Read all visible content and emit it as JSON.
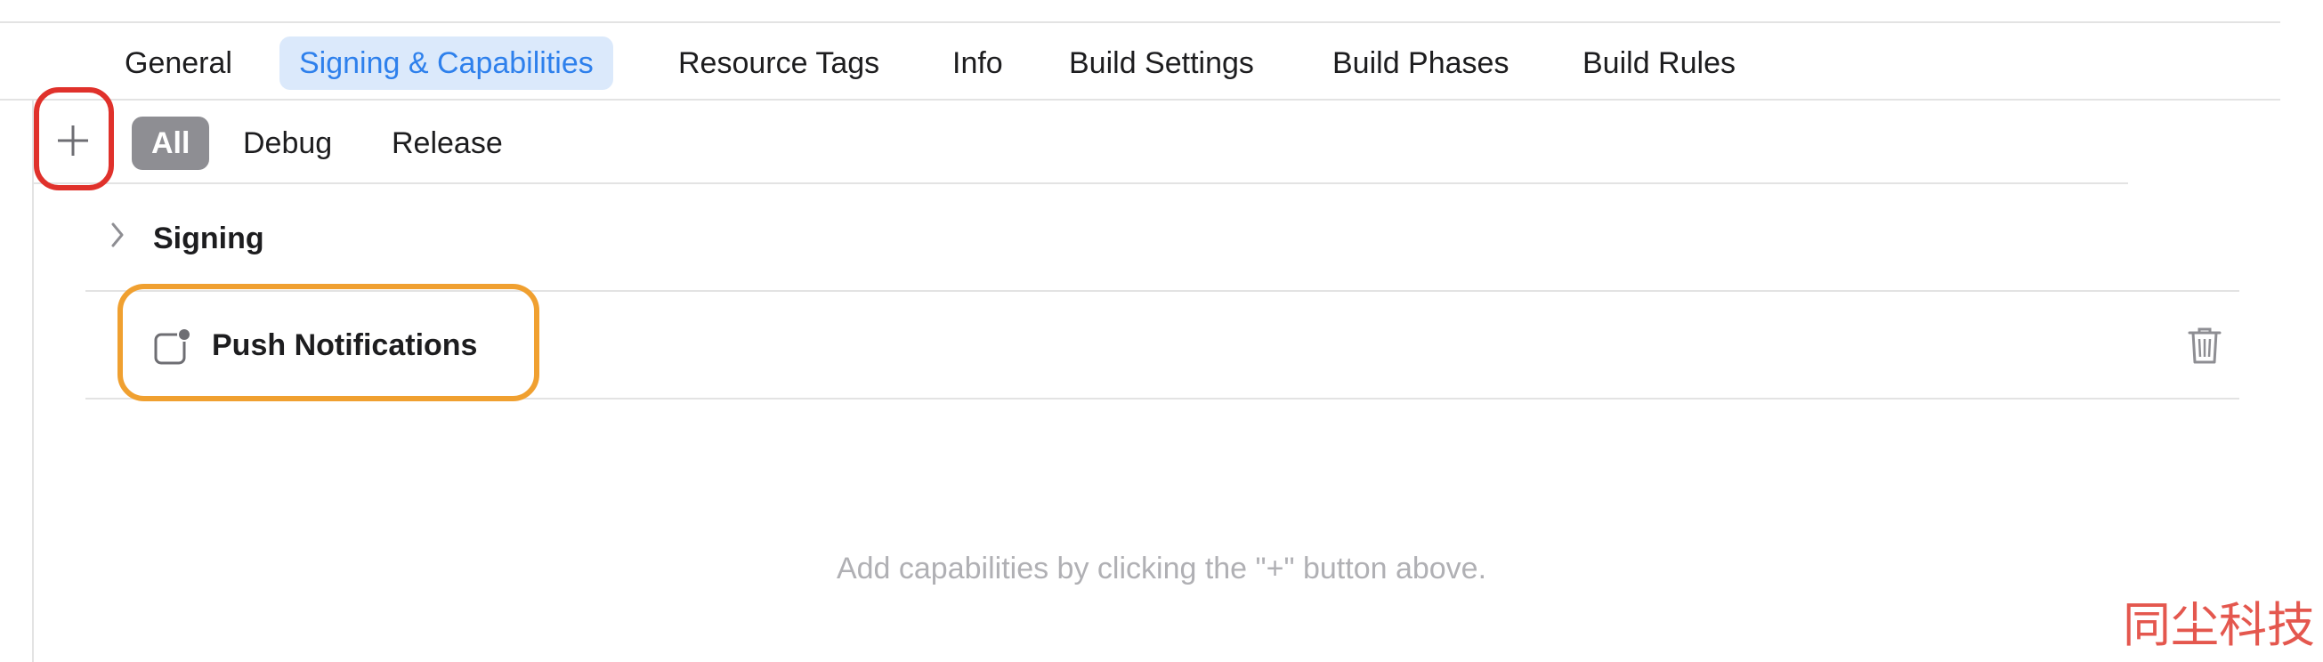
{
  "tabs": [
    {
      "label": "General"
    },
    {
      "label": "Signing & Capabilities",
      "active": true
    },
    {
      "label": "Resource Tags"
    },
    {
      "label": "Info"
    },
    {
      "label": "Build Settings"
    },
    {
      "label": "Build Phases"
    },
    {
      "label": "Build Rules"
    }
  ],
  "toolbar": {
    "add_icon": "plus-icon",
    "configurations": [
      {
        "label": "All",
        "active": true
      },
      {
        "label": "Debug"
      },
      {
        "label": "Release"
      }
    ]
  },
  "sections": {
    "signing": {
      "label": "Signing",
      "icon": "chevron-right-icon"
    },
    "push": {
      "label": "Push Notifications",
      "icon": "notification-badge-icon",
      "delete_icon": "trash-icon"
    }
  },
  "hint": "Add capabilities by clicking the \"+\" button above.",
  "watermark": "同尘科技",
  "colors": {
    "accent": "#2e80ec",
    "tab_active_bg": "#dbe9fb",
    "segment_active_bg": "#8e8e93",
    "annotation_red": "#e0312b",
    "annotation_orange": "#f0a030",
    "watermark": "#e4574e"
  }
}
